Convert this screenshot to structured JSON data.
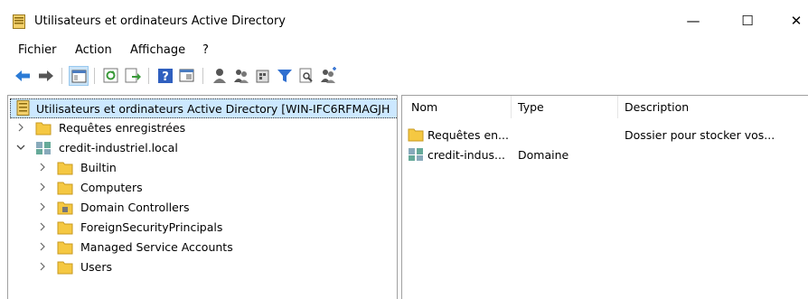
{
  "window": {
    "title": "Utilisateurs et ordinateurs Active Directory",
    "min_glyph": "—",
    "max_glyph": "☐",
    "close_glyph": "✕"
  },
  "menu": [
    {
      "label": "Fichier"
    },
    {
      "label": "Action"
    },
    {
      "label": "Affichage"
    },
    {
      "label": "?"
    }
  ],
  "toolbar_icons": [
    "back-arrow-icon",
    "forward-arrow-icon",
    "console-tree-icon",
    "refresh-icon",
    "export-list-icon",
    "help-icon",
    "properties-icon",
    "new-user-icon",
    "new-group-icon",
    "new-ou-icon",
    "filter-icon",
    "find-icon",
    "add-to-group-icon"
  ],
  "tree": {
    "root": "Utilisateurs et ordinateurs Active Directory [WIN-IFC6RFMAGJH",
    "saved_queries": "Requêtes enregistrées",
    "domain": "credit-industriel.local",
    "children": [
      {
        "label": "Builtin"
      },
      {
        "label": "Computers"
      },
      {
        "label": "Domain Controllers"
      },
      {
        "label": "ForeignSecurityPrincipals"
      },
      {
        "label": "Managed Service Accounts"
      },
      {
        "label": "Users"
      }
    ]
  },
  "list": {
    "columns": {
      "name": "Nom",
      "type": "Type",
      "description": "Description"
    },
    "rows": [
      {
        "name": "Requêtes en...",
        "type": "",
        "description": "Dossier pour stocker vos..."
      },
      {
        "name": "credit-indus...",
        "type": "Domaine",
        "description": ""
      }
    ]
  },
  "colors": {
    "selection": "#cce8ff",
    "folder": "#f5c842",
    "arrow": "#2b7bd6"
  }
}
